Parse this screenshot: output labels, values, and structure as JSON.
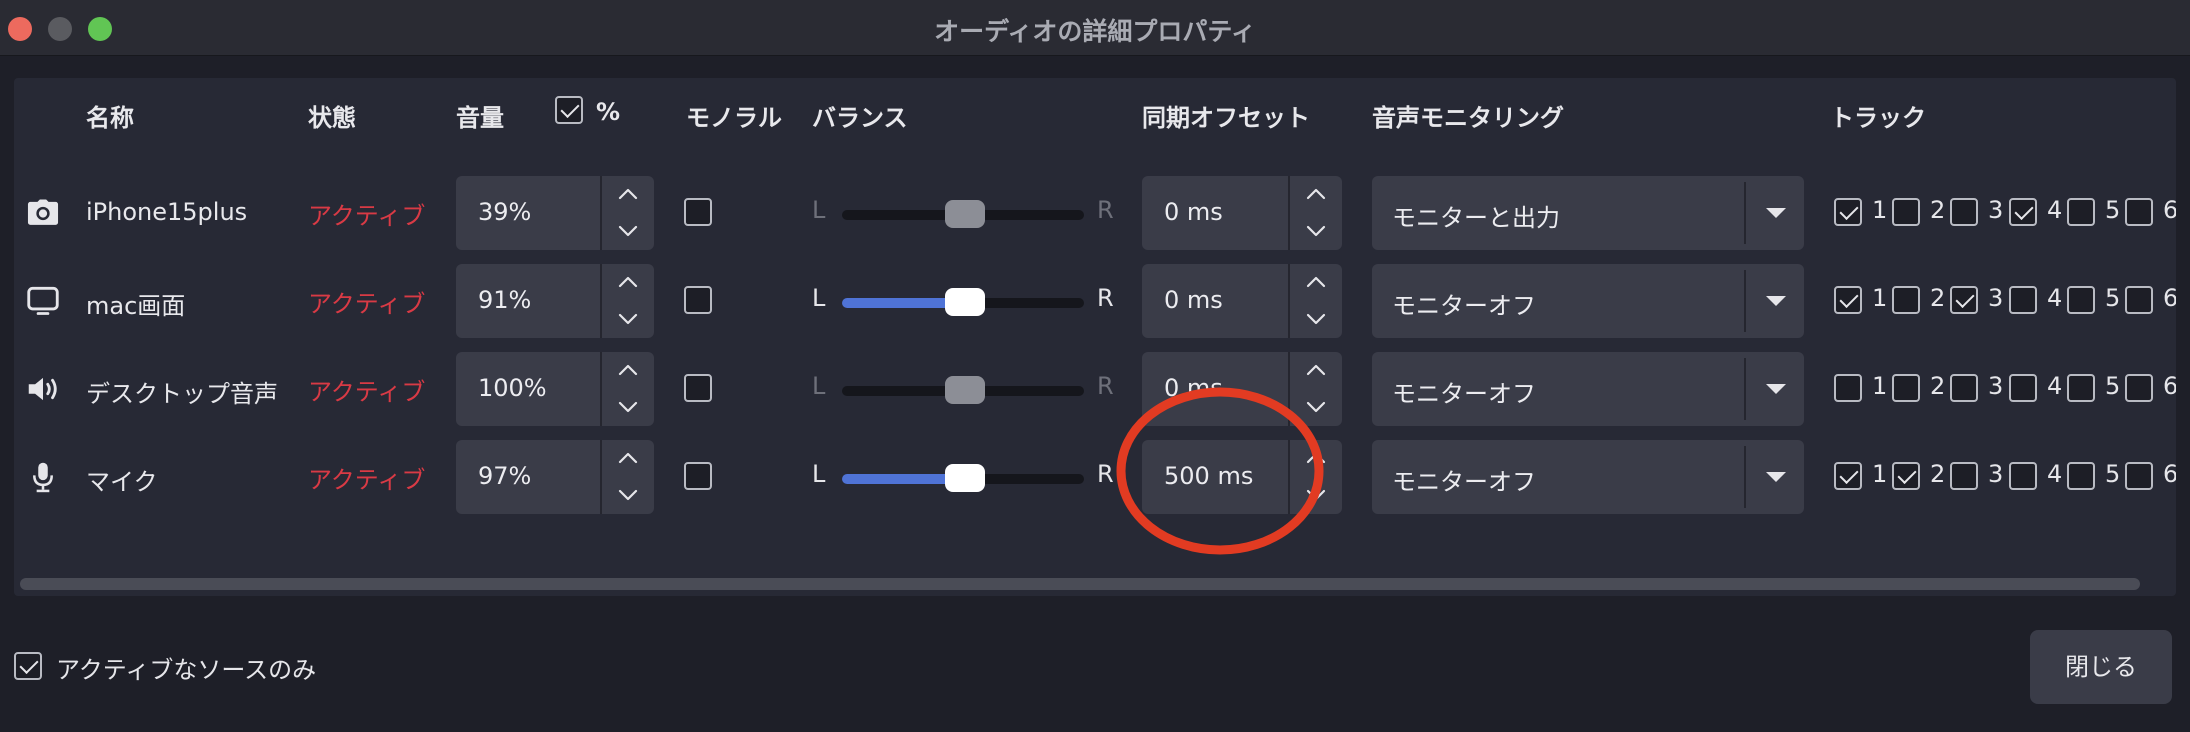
{
  "window": {
    "title": "オーディオの詳細プロパティ"
  },
  "columns": {
    "name": "名称",
    "state": "状態",
    "volume": "音量",
    "percent_label": "%",
    "percent_checked": true,
    "mono": "モノラル",
    "balance": "バランス",
    "sync_offset": "同期オフセット",
    "monitoring": "音声モニタリング",
    "tracks": "トラック"
  },
  "rows": [
    {
      "icon": "camera-icon",
      "name": "iPhone15plus",
      "state": "アクティブ",
      "volume": "39%",
      "mono": false,
      "balance_left": "L",
      "balance_right": "R",
      "balance_value": 0.5,
      "balance_enabled": false,
      "offset": "0 ms",
      "monitoring": "モニターと出力",
      "tracks": [
        true,
        false,
        false,
        true,
        false,
        false
      ]
    },
    {
      "icon": "monitor-icon",
      "name": "mac画面",
      "state": "アクティブ",
      "volume": "91%",
      "mono": false,
      "balance_left": "L",
      "balance_right": "R",
      "balance_value": 0.5,
      "balance_enabled": true,
      "offset": "0 ms",
      "monitoring": "モニターオフ",
      "tracks": [
        true,
        false,
        true,
        false,
        false,
        false
      ]
    },
    {
      "icon": "speaker-icon",
      "name": "デスクトップ音声",
      "state": "アクティブ",
      "volume": "100%",
      "mono": false,
      "balance_left": "L",
      "balance_right": "R",
      "balance_value": 0.5,
      "balance_enabled": false,
      "offset": "0 ms",
      "monitoring": "モニターオフ",
      "tracks": [
        false,
        false,
        false,
        false,
        false,
        false
      ]
    },
    {
      "icon": "microphone-icon",
      "name": "マイク",
      "state": "アクティブ",
      "volume": "97%",
      "mono": false,
      "balance_left": "L",
      "balance_right": "R",
      "balance_value": 0.5,
      "balance_enabled": true,
      "offset": "500 ms",
      "monitoring": "モニターオフ",
      "tracks": [
        true,
        true,
        false,
        false,
        false,
        false
      ]
    }
  ],
  "track_numbers": [
    "1",
    "2",
    "3",
    "4",
    "5",
    "6"
  ],
  "footer": {
    "active_only_label": "アクティブなソースのみ",
    "active_only_checked": true,
    "close_label": "閉じる"
  },
  "colors": {
    "background": "#1e1f28",
    "panel": "#272935",
    "field": "#3a3c48",
    "active_state": "#d93a45",
    "balance_fill": "#4f73d6",
    "annotation": "#e23b22"
  }
}
